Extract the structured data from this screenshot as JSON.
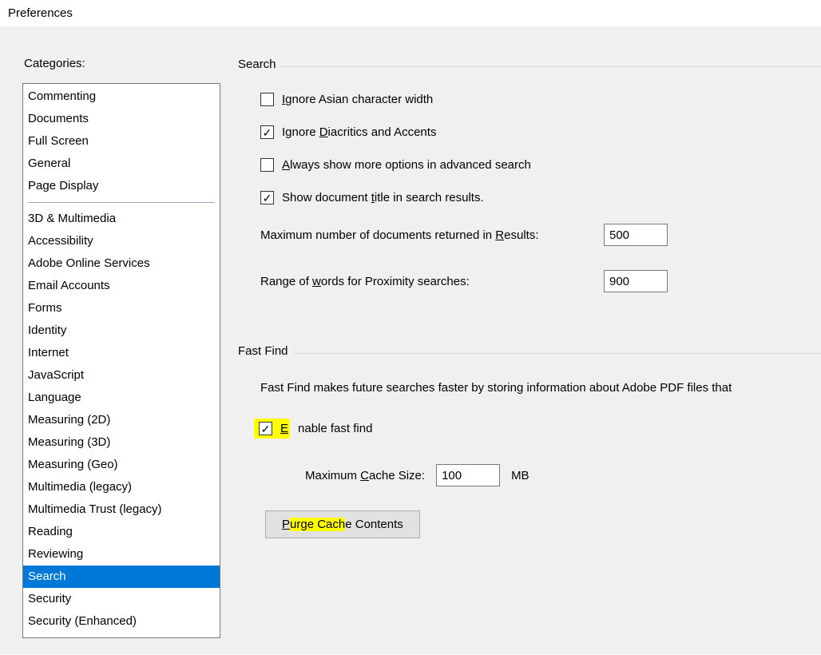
{
  "window": {
    "title": "Preferences"
  },
  "sidebar": {
    "label": "Categories:",
    "group1": [
      {
        "label": "Commenting"
      },
      {
        "label": "Documents"
      },
      {
        "label": "Full Screen"
      },
      {
        "label": "General"
      },
      {
        "label": "Page Display"
      }
    ],
    "group2": [
      {
        "label": "3D & Multimedia"
      },
      {
        "label": "Accessibility"
      },
      {
        "label": "Adobe Online Services"
      },
      {
        "label": "Email Accounts"
      },
      {
        "label": "Forms"
      },
      {
        "label": "Identity"
      },
      {
        "label": "Internet"
      },
      {
        "label": "JavaScript"
      },
      {
        "label": "Language"
      },
      {
        "label": "Measuring (2D)"
      },
      {
        "label": "Measuring (3D)"
      },
      {
        "label": "Measuring (Geo)"
      },
      {
        "label": "Multimedia (legacy)"
      },
      {
        "label": "Multimedia Trust (legacy)"
      },
      {
        "label": "Reading"
      },
      {
        "label": "Reviewing"
      },
      {
        "label": "Search",
        "selected": true
      },
      {
        "label": "Security"
      },
      {
        "label": "Security (Enhanced)"
      }
    ]
  },
  "search": {
    "title": "Search",
    "ignore_asian": {
      "label_pre": "",
      "label_u": "I",
      "label_post": "gnore Asian character width",
      "checked": false
    },
    "ignore_diacritics": {
      "label_pre": "Ignore ",
      "label_u": "D",
      "label_post": "iacritics and Accents",
      "checked": true
    },
    "always_show": {
      "label_pre": "",
      "label_u": "A",
      "label_post": "lways show more options in advanced search",
      "checked": false
    },
    "show_title": {
      "label_pre": "Show document ",
      "label_u": "t",
      "label_post": "itle in search results.",
      "checked": true
    },
    "max_docs": {
      "label_pre": "Maximum number of documents returned in ",
      "label_u": "R",
      "label_post": "esults:",
      "value": "500"
    },
    "proximity": {
      "label_pre": "Range of ",
      "label_u": "w",
      "label_post": "ords for Proximity searches:",
      "value": "900"
    }
  },
  "fastfind": {
    "title": "Fast Find",
    "desc": "Fast Find makes future searches faster by storing information about Adobe PDF files that",
    "enable": {
      "label_pre": "",
      "label_u": "E",
      "label_post": "nable fast find",
      "checked": true
    },
    "cache": {
      "label_pre": "Maximum ",
      "label_u": "C",
      "label_post": "ache Size:",
      "value": "100",
      "unit": "MB"
    },
    "purge": {
      "label_pre": "",
      "label_u": "P",
      "label_hl": "urge Cach",
      "label_post": "e Contents"
    }
  }
}
